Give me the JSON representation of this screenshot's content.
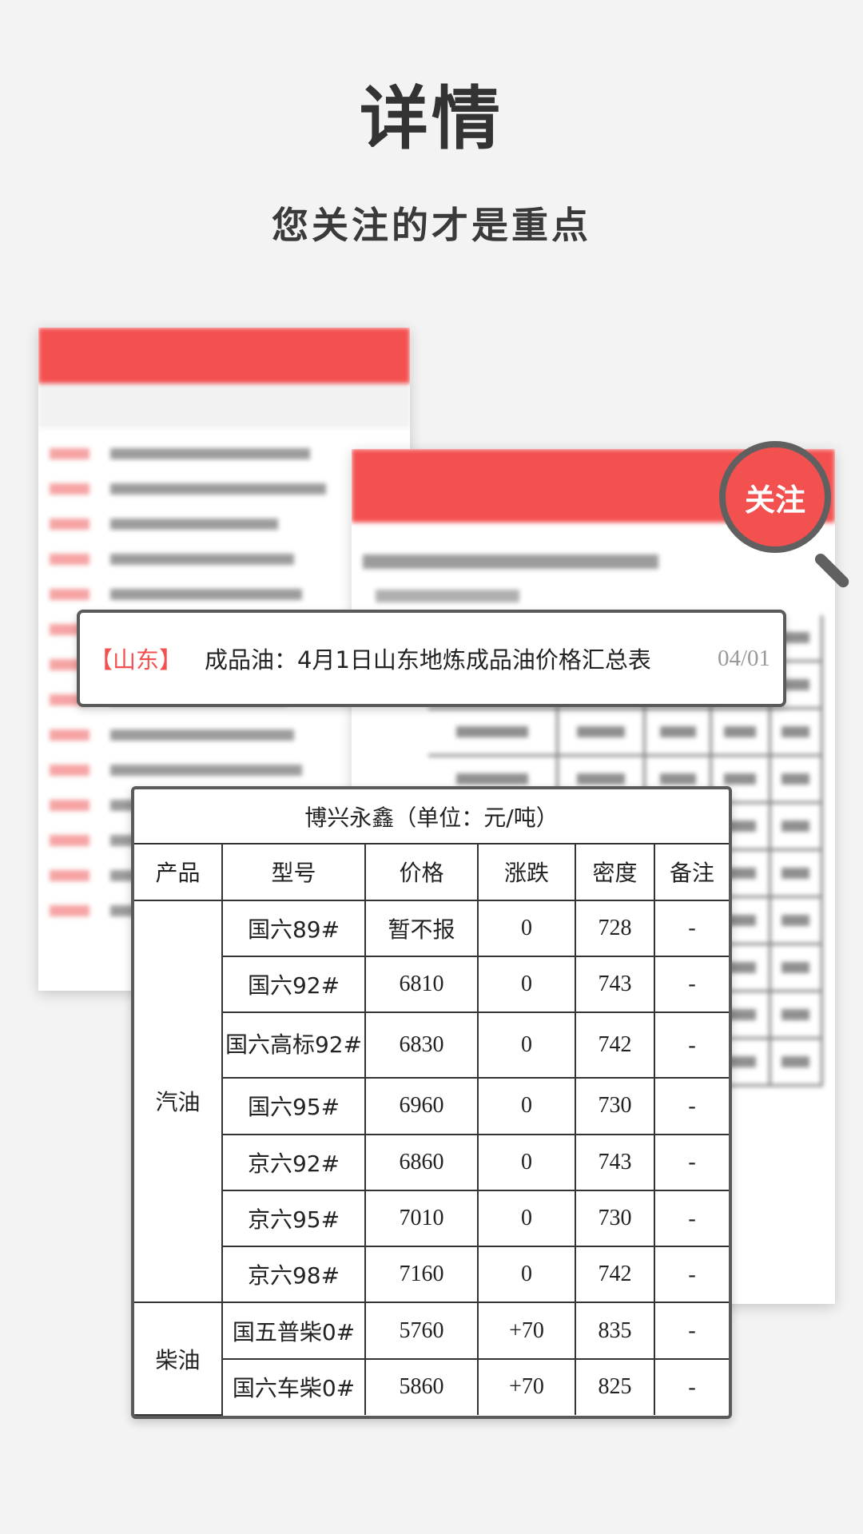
{
  "hero": {
    "title": "详情",
    "subtitle": "您关注的才是重点"
  },
  "magnifier": {
    "label": "关注"
  },
  "news_card": {
    "region": "【山东】",
    "title": "成品油：4月1日山东地炼成品油价格汇总表",
    "date": "04/01"
  },
  "price_table": {
    "caption": "博兴永鑫（单位：元/吨）",
    "headers": [
      "产品",
      "型号",
      "价格",
      "涨跌",
      "密度",
      "备注"
    ],
    "groups": [
      {
        "product": "汽油",
        "rows": [
          {
            "model": "国六89#",
            "price": "暂不报",
            "change": "0",
            "density": "728",
            "note": "-"
          },
          {
            "model": "国六92#",
            "price": "6810",
            "change": "0",
            "density": "743",
            "note": "-"
          },
          {
            "model": "国六高标92#",
            "price": "6830",
            "change": "0",
            "density": "742",
            "note": "-"
          },
          {
            "model": "国六95#",
            "price": "6960",
            "change": "0",
            "density": "730",
            "note": "-"
          },
          {
            "model": "京六92#",
            "price": "6860",
            "change": "0",
            "density": "743",
            "note": "-"
          },
          {
            "model": "京六95#",
            "price": "7010",
            "change": "0",
            "density": "730",
            "note": "-"
          },
          {
            "model": "京六98#",
            "price": "7160",
            "change": "0",
            "density": "742",
            "note": "-"
          }
        ]
      },
      {
        "product": "柴油",
        "rows": [
          {
            "model": "国五普柴0#",
            "price": "5760",
            "change": "+70",
            "density": "835",
            "note": "-"
          },
          {
            "model": "国六车柴0#",
            "price": "5860",
            "change": "+70",
            "density": "825",
            "note": "-"
          }
        ]
      }
    ]
  },
  "colors": {
    "accent": "#f35050",
    "background": "#f3f3f3",
    "frame": "#5a5a5a"
  }
}
